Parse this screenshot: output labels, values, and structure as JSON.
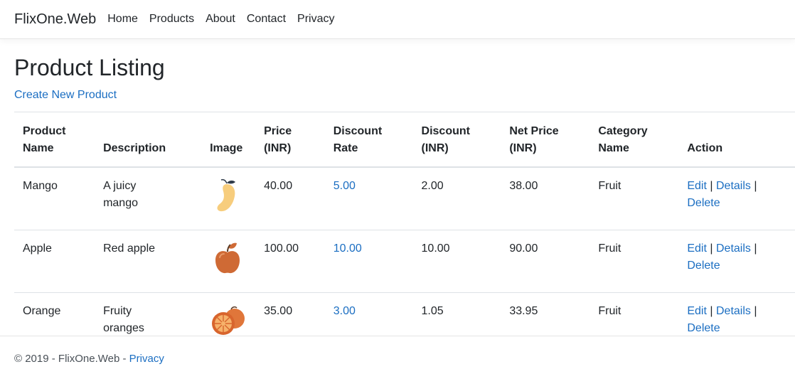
{
  "nav": {
    "brand": "FlixOne.Web",
    "links": [
      "Home",
      "Products",
      "About",
      "Contact",
      "Privacy"
    ]
  },
  "page": {
    "title": "Product Listing",
    "create_link": "Create New Product"
  },
  "table": {
    "headers": [
      [
        "Product",
        "Name"
      ],
      [
        "",
        "Description"
      ],
      [
        "",
        "Image"
      ],
      [
        "Price",
        "(INR)"
      ],
      [
        "Discount",
        "Rate"
      ],
      [
        "Discount",
        "(INR)"
      ],
      [
        "Net Price",
        "(INR)"
      ],
      [
        "Category",
        "Name"
      ],
      [
        "",
        "Action"
      ]
    ],
    "rows": [
      {
        "name": "Mango",
        "description": [
          "A juicy",
          "mango"
        ],
        "image": "mango-icon",
        "price": "40.00",
        "discount_rate": "5.00",
        "discount": "2.00",
        "net_price": "38.00",
        "category": "Fruit"
      },
      {
        "name": "Apple",
        "description": [
          "Red apple"
        ],
        "image": "apple-icon",
        "price": "100.00",
        "discount_rate": "10.00",
        "discount": "10.00",
        "net_price": "90.00",
        "category": "Fruit"
      },
      {
        "name": "Orange",
        "description": [
          "Fruity",
          "oranges"
        ],
        "image": "orange-icon",
        "price": "35.00",
        "discount_rate": "3.00",
        "discount": "1.05",
        "net_price": "33.95",
        "category": "Fruit"
      }
    ],
    "actions": {
      "edit": "Edit",
      "details": "Details",
      "delete": "Delete",
      "separator": "|"
    }
  },
  "footer": {
    "copyright": "© 2019 - FlixOne.Web - ",
    "privacy": "Privacy"
  },
  "colors": {
    "link": "#1b6ec2",
    "text": "#212529",
    "border": "#dee2e6",
    "mango": "#f7cd7d",
    "apple": "#cf6a35",
    "orange": "#e0763a"
  }
}
